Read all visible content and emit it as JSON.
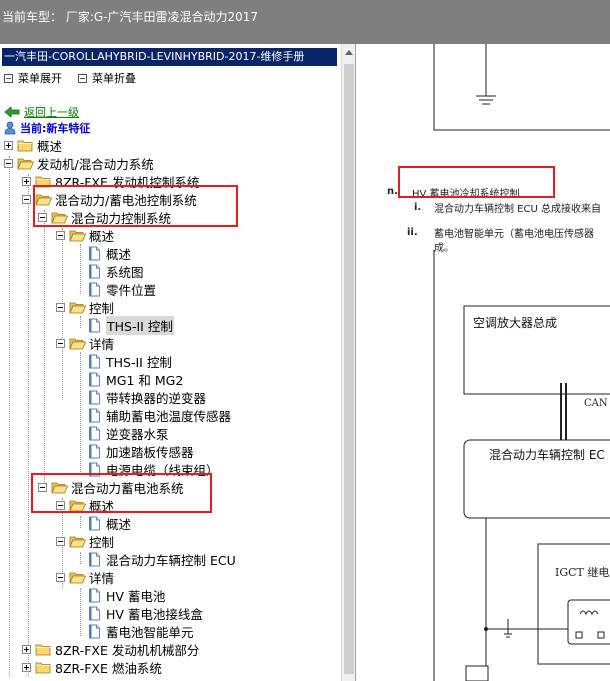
{
  "window": {
    "title": "当前车型：  厂家:G-广汽丰田雷凌混合动力2017"
  },
  "left": {
    "manual_title": "一汽丰田-COROLLAHYBRID-LEVINHYBRID-2017-维修手册",
    "expand_menu": "菜单展开",
    "collapse_menu": "菜单折叠",
    "back_link": "返回上一级",
    "current": "当前:新车特征"
  },
  "tree": {
    "overview": "概述",
    "engine_hybrid": "发动机/混合动力系统",
    "engine_control_8zr": "8ZR-FXE 发动机控制系统",
    "hybrid_battery_control": "混合动力/蓄电池控制系统",
    "hybrid_control_system": "混合动力控制系统",
    "hcs_overview": "概述",
    "hcs_overview_item1": "概述",
    "hcs_overview_item2": "系统图",
    "hcs_overview_item3": "零件位置",
    "hcs_control": "控制",
    "hcs_control_item1": "THS-II 控制",
    "hcs_detail": "详情",
    "hcs_detail_item1": "THS-II 控制",
    "hcs_detail_item2": "MG1 和 MG2",
    "hcs_detail_item3": "带转换器的逆变器",
    "hcs_detail_item4": "辅助蓄电池温度传感器",
    "hcs_detail_item5": "逆变器水泵",
    "hcs_detail_item6": "加速踏板传感器",
    "hcs_detail_item7": "电源电缆（线束组）",
    "hybrid_battery_system": "混合动力蓄电池系统",
    "hbs_overview": "概述",
    "hbs_overview_item1": "概述",
    "hbs_control": "控制",
    "hbs_control_item1": "混合动力车辆控制 ECU",
    "hbs_detail": "详情",
    "hbs_detail_item1": "HV 蓄电池",
    "hbs_detail_item2": "HV 蓄电池接线盒",
    "hbs_detail_item3": "蓄电池智能单元",
    "engine_mech_8zr": "8ZR-FXE 发动机机械部分",
    "fuel_8zr": "8ZR-FXE 燃油系统"
  },
  "right": {
    "n_mark": "n.",
    "n_title": "HV 蓄电池冷却系统控制",
    "i_mark": "i.",
    "i_text": "混合动力车辆控制 ECU 总成接收来自",
    "ii_mark": "ii.",
    "ii_text": "蓄电池智能单元（蓄电池电压传感器",
    "ii_text2": "成。",
    "ac_amp": "空调放大器总成",
    "can": "CAN",
    "hv_ecu": "混合动力车辆控制 EC",
    "igct": "IGCT 继电"
  },
  "colors": {
    "highlight": "#e02020",
    "header_bg": "#0a246a",
    "topbar_bg": "#7f7f7f"
  }
}
